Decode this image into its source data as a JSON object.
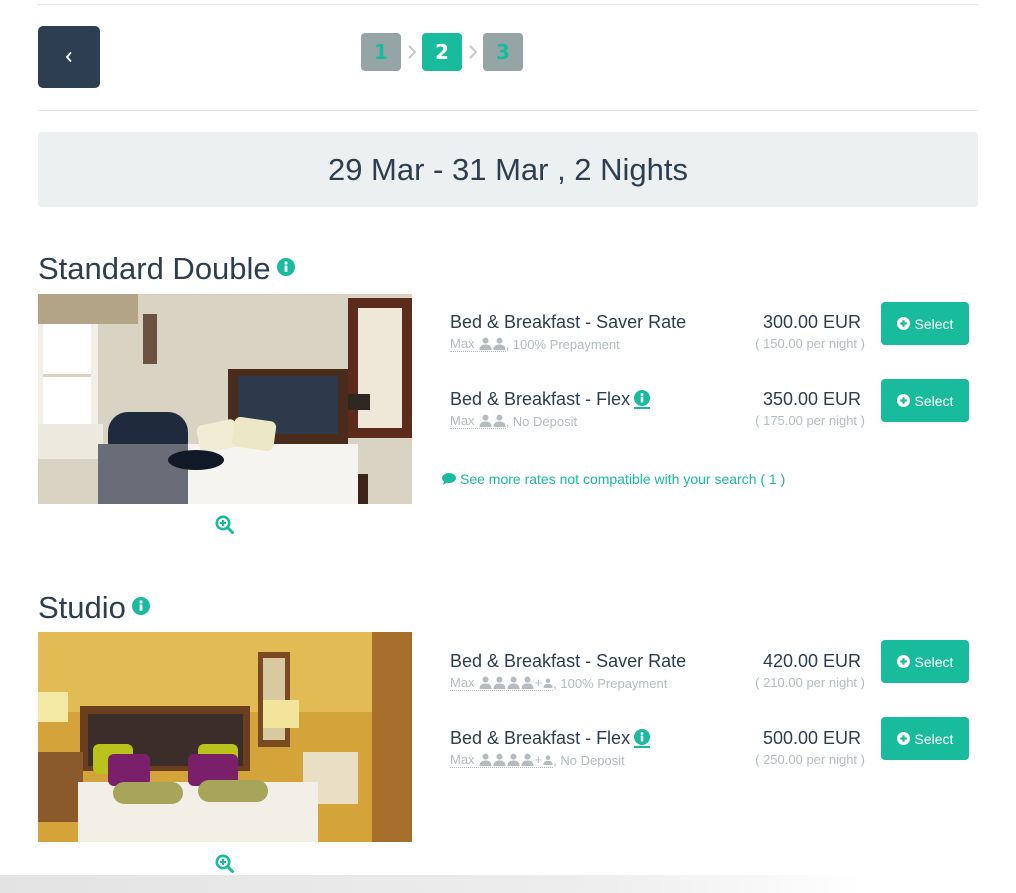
{
  "nav": {
    "back_icon": "chevron-left-icon",
    "steps": [
      {
        "label": "1",
        "state": "done"
      },
      {
        "label": "2",
        "state": "active"
      },
      {
        "label": "3",
        "state": "todo"
      }
    ]
  },
  "stay": {
    "summary": "29 Mar - 31 Mar , 2 Nights"
  },
  "rooms": [
    {
      "title": "Standard Double",
      "info_icon": "info-icon",
      "zoom_icon": "zoom-in-icon",
      "rates": [
        {
          "name": "Bed & Breakfast - Saver Rate",
          "max_label": "Max",
          "occupancy": "2 adults",
          "policy": ", 100% Prepayment",
          "price": "300.00 EUR",
          "per_night": "( 150.00 per night )",
          "select_label": "Select"
        },
        {
          "name": "Bed & Breakfast - Flex",
          "max_label": "Max",
          "occupancy": "2 adults",
          "policy": ", No Deposit",
          "price": "350.00 EUR",
          "per_night": "( 175.00 per night )",
          "select_label": "Select"
        }
      ],
      "more_rates": "See more rates not compatible with your search ( 1 )"
    },
    {
      "title": "Studio",
      "info_icon": "info-icon",
      "zoom_icon": "zoom-in-icon",
      "rates": [
        {
          "name": "Bed & Breakfast - Saver Rate",
          "max_label": "Max",
          "occupancy": "4 adults + 1 child",
          "policy": ", 100% Prepayment",
          "price": "420.00 EUR",
          "per_night": "( 210.00 per night )",
          "select_label": "Select"
        },
        {
          "name": "Bed & Breakfast - Flex",
          "max_label": "Max",
          "occupancy": "4 adults + 1 child",
          "policy": ", No Deposit",
          "price": "500.00 EUR",
          "per_night": "( 250.00 per night )",
          "select_label": "Select"
        }
      ]
    }
  ],
  "colors": {
    "accent": "#18bc9c",
    "dark": "#2c3e50",
    "muted": "#b4bcbf",
    "step_inactive": "#95a5a6",
    "bar_bg": "#ecf0f1"
  }
}
